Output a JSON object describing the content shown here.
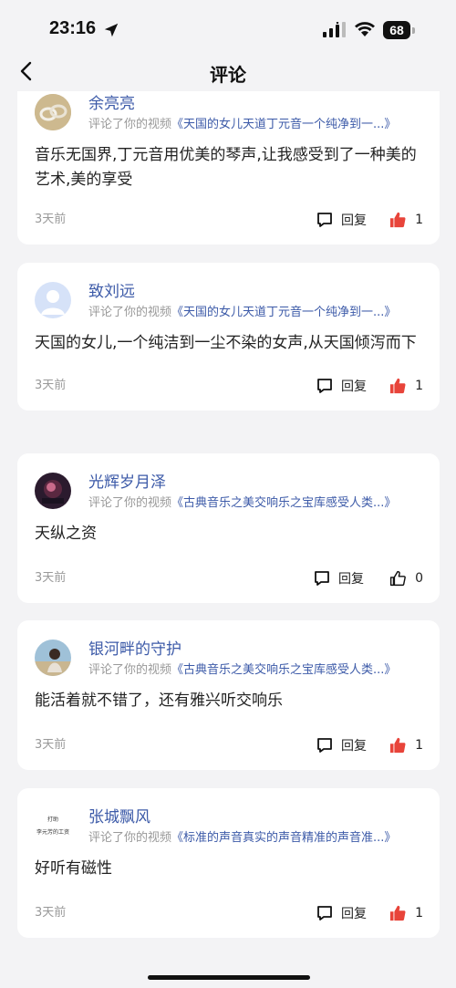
{
  "status_bar": {
    "time": "23:16",
    "battery": "68"
  },
  "nav": {
    "title": "评论"
  },
  "comments": [
    {
      "author": "余亮亮",
      "action": "评论了你的视频",
      "video": "《天国的女儿天道丁元音一个纯净到一...》",
      "content": "音乐无国界,丁元音用优美的琴声,让我感受到了一种美的艺术,美的享受",
      "time": "3天前",
      "reply_label": "回复",
      "likes": "1",
      "liked": true
    },
    {
      "author": "致刘远",
      "action": "评论了你的视频",
      "video": "《天国的女儿天道丁元音一个纯净到一...》",
      "content": "天国的女儿,一个纯洁到一尘不染的女声,从天国倾泻而下",
      "time": "3天前",
      "reply_label": "回复",
      "likes": "1",
      "liked": true
    },
    {
      "author": "光辉岁月泽",
      "action": "评论了你的视频",
      "video": "《古典音乐之美交响乐之宝库感受人类...》",
      "content": "天纵之资",
      "time": "3天前",
      "reply_label": "回复",
      "likes": "0",
      "liked": false
    },
    {
      "author": "银河畔的守护",
      "action": "评论了你的视频",
      "video": "《古典音乐之美交响乐之宝库感受人类...》",
      "content": "能活着就不错了，还有雅兴听交响乐",
      "time": "3天前",
      "reply_label": "回复",
      "likes": "1",
      "liked": true
    },
    {
      "author": "张城飘风",
      "action": "评论了你的视频",
      "video": "《标准的声音真实的声音精准的声音准...》",
      "content": "好听有磁性",
      "time": "3天前",
      "reply_label": "回复",
      "likes": "1",
      "liked": true,
      "avatar_text_1": "打助",
      "avatar_text_2": "李元芳的工资"
    }
  ],
  "colors": {
    "accent": "#3c5aa8",
    "like_active": "#e8443a",
    "background": "#f3f3f5"
  }
}
